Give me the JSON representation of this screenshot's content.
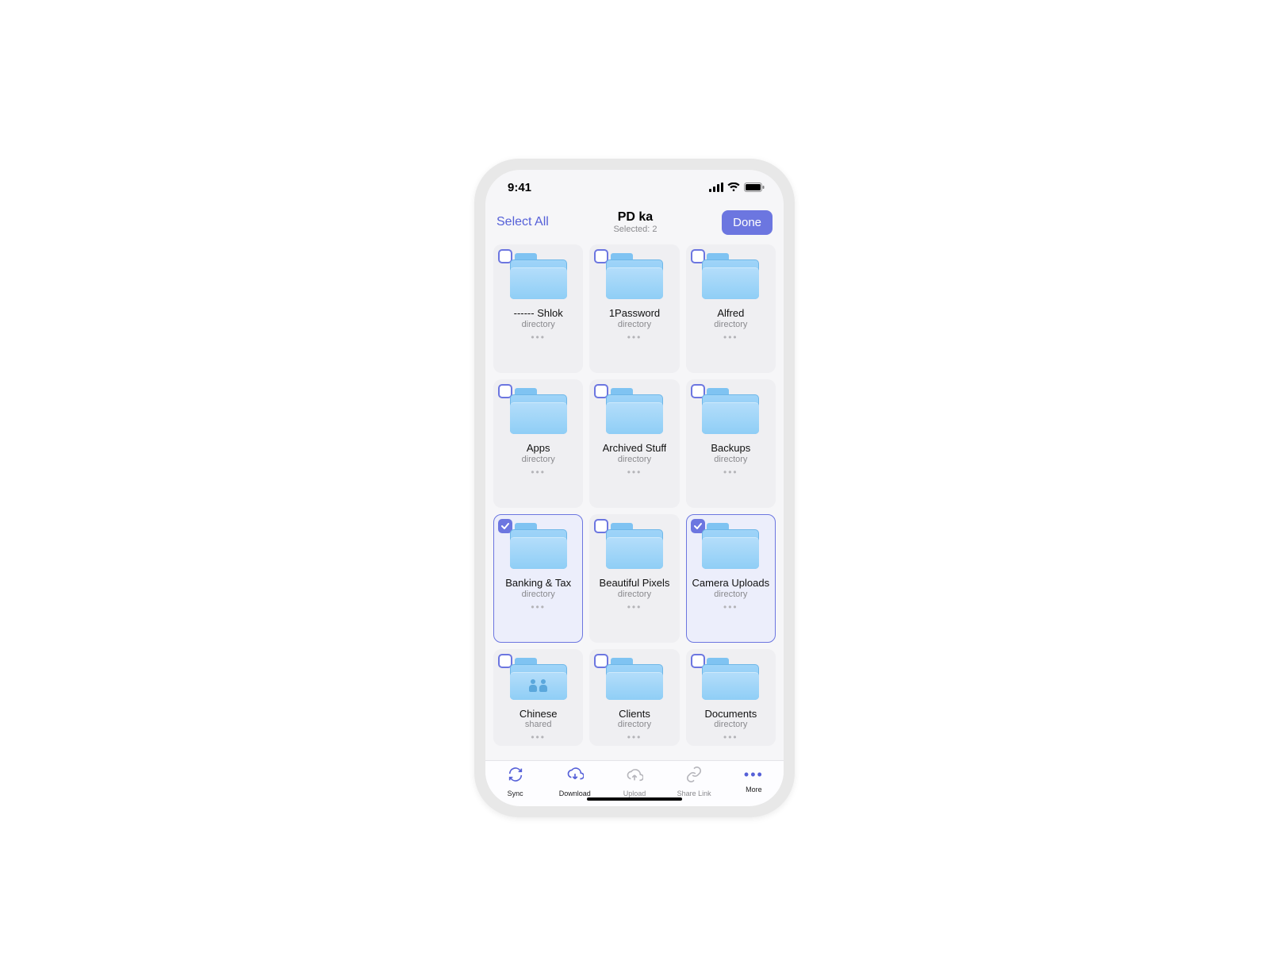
{
  "status": {
    "time": "9:41"
  },
  "nav": {
    "select_all": "Select All",
    "title": "PD ka",
    "subtitle": "Selected: 2",
    "done": "Done"
  },
  "folders": [
    {
      "name": "------ Shlok",
      "type": "directory",
      "selected": false,
      "shared": false
    },
    {
      "name": "1Password",
      "type": "directory",
      "selected": false,
      "shared": false
    },
    {
      "name": "Alfred",
      "type": "directory",
      "selected": false,
      "shared": false
    },
    {
      "name": "Apps",
      "type": "directory",
      "selected": false,
      "shared": false
    },
    {
      "name": "Archived Stuff",
      "type": "directory",
      "selected": false,
      "shared": false
    },
    {
      "name": "Backups",
      "type": "directory",
      "selected": false,
      "shared": false
    },
    {
      "name": "Banking & Tax",
      "type": "directory",
      "selected": true,
      "shared": false
    },
    {
      "name": "Beautiful Pixels",
      "type": "directory",
      "selected": false,
      "shared": false
    },
    {
      "name": "Camera Uploads",
      "type": "directory",
      "selected": true,
      "shared": false
    },
    {
      "name": "Chinese",
      "type": "shared",
      "selected": false,
      "shared": true
    },
    {
      "name": "Clients",
      "type": "directory",
      "selected": false,
      "shared": false
    },
    {
      "name": "Documents",
      "type": "directory",
      "selected": false,
      "shared": false
    }
  ],
  "toolbar": [
    {
      "id": "sync",
      "label": "Sync",
      "enabled": true
    },
    {
      "id": "download",
      "label": "Download",
      "enabled": true
    },
    {
      "id": "upload",
      "label": "Upload",
      "enabled": false
    },
    {
      "id": "sharelink",
      "label": "Share Link",
      "enabled": false
    },
    {
      "id": "more",
      "label": "More",
      "enabled": true
    }
  ]
}
